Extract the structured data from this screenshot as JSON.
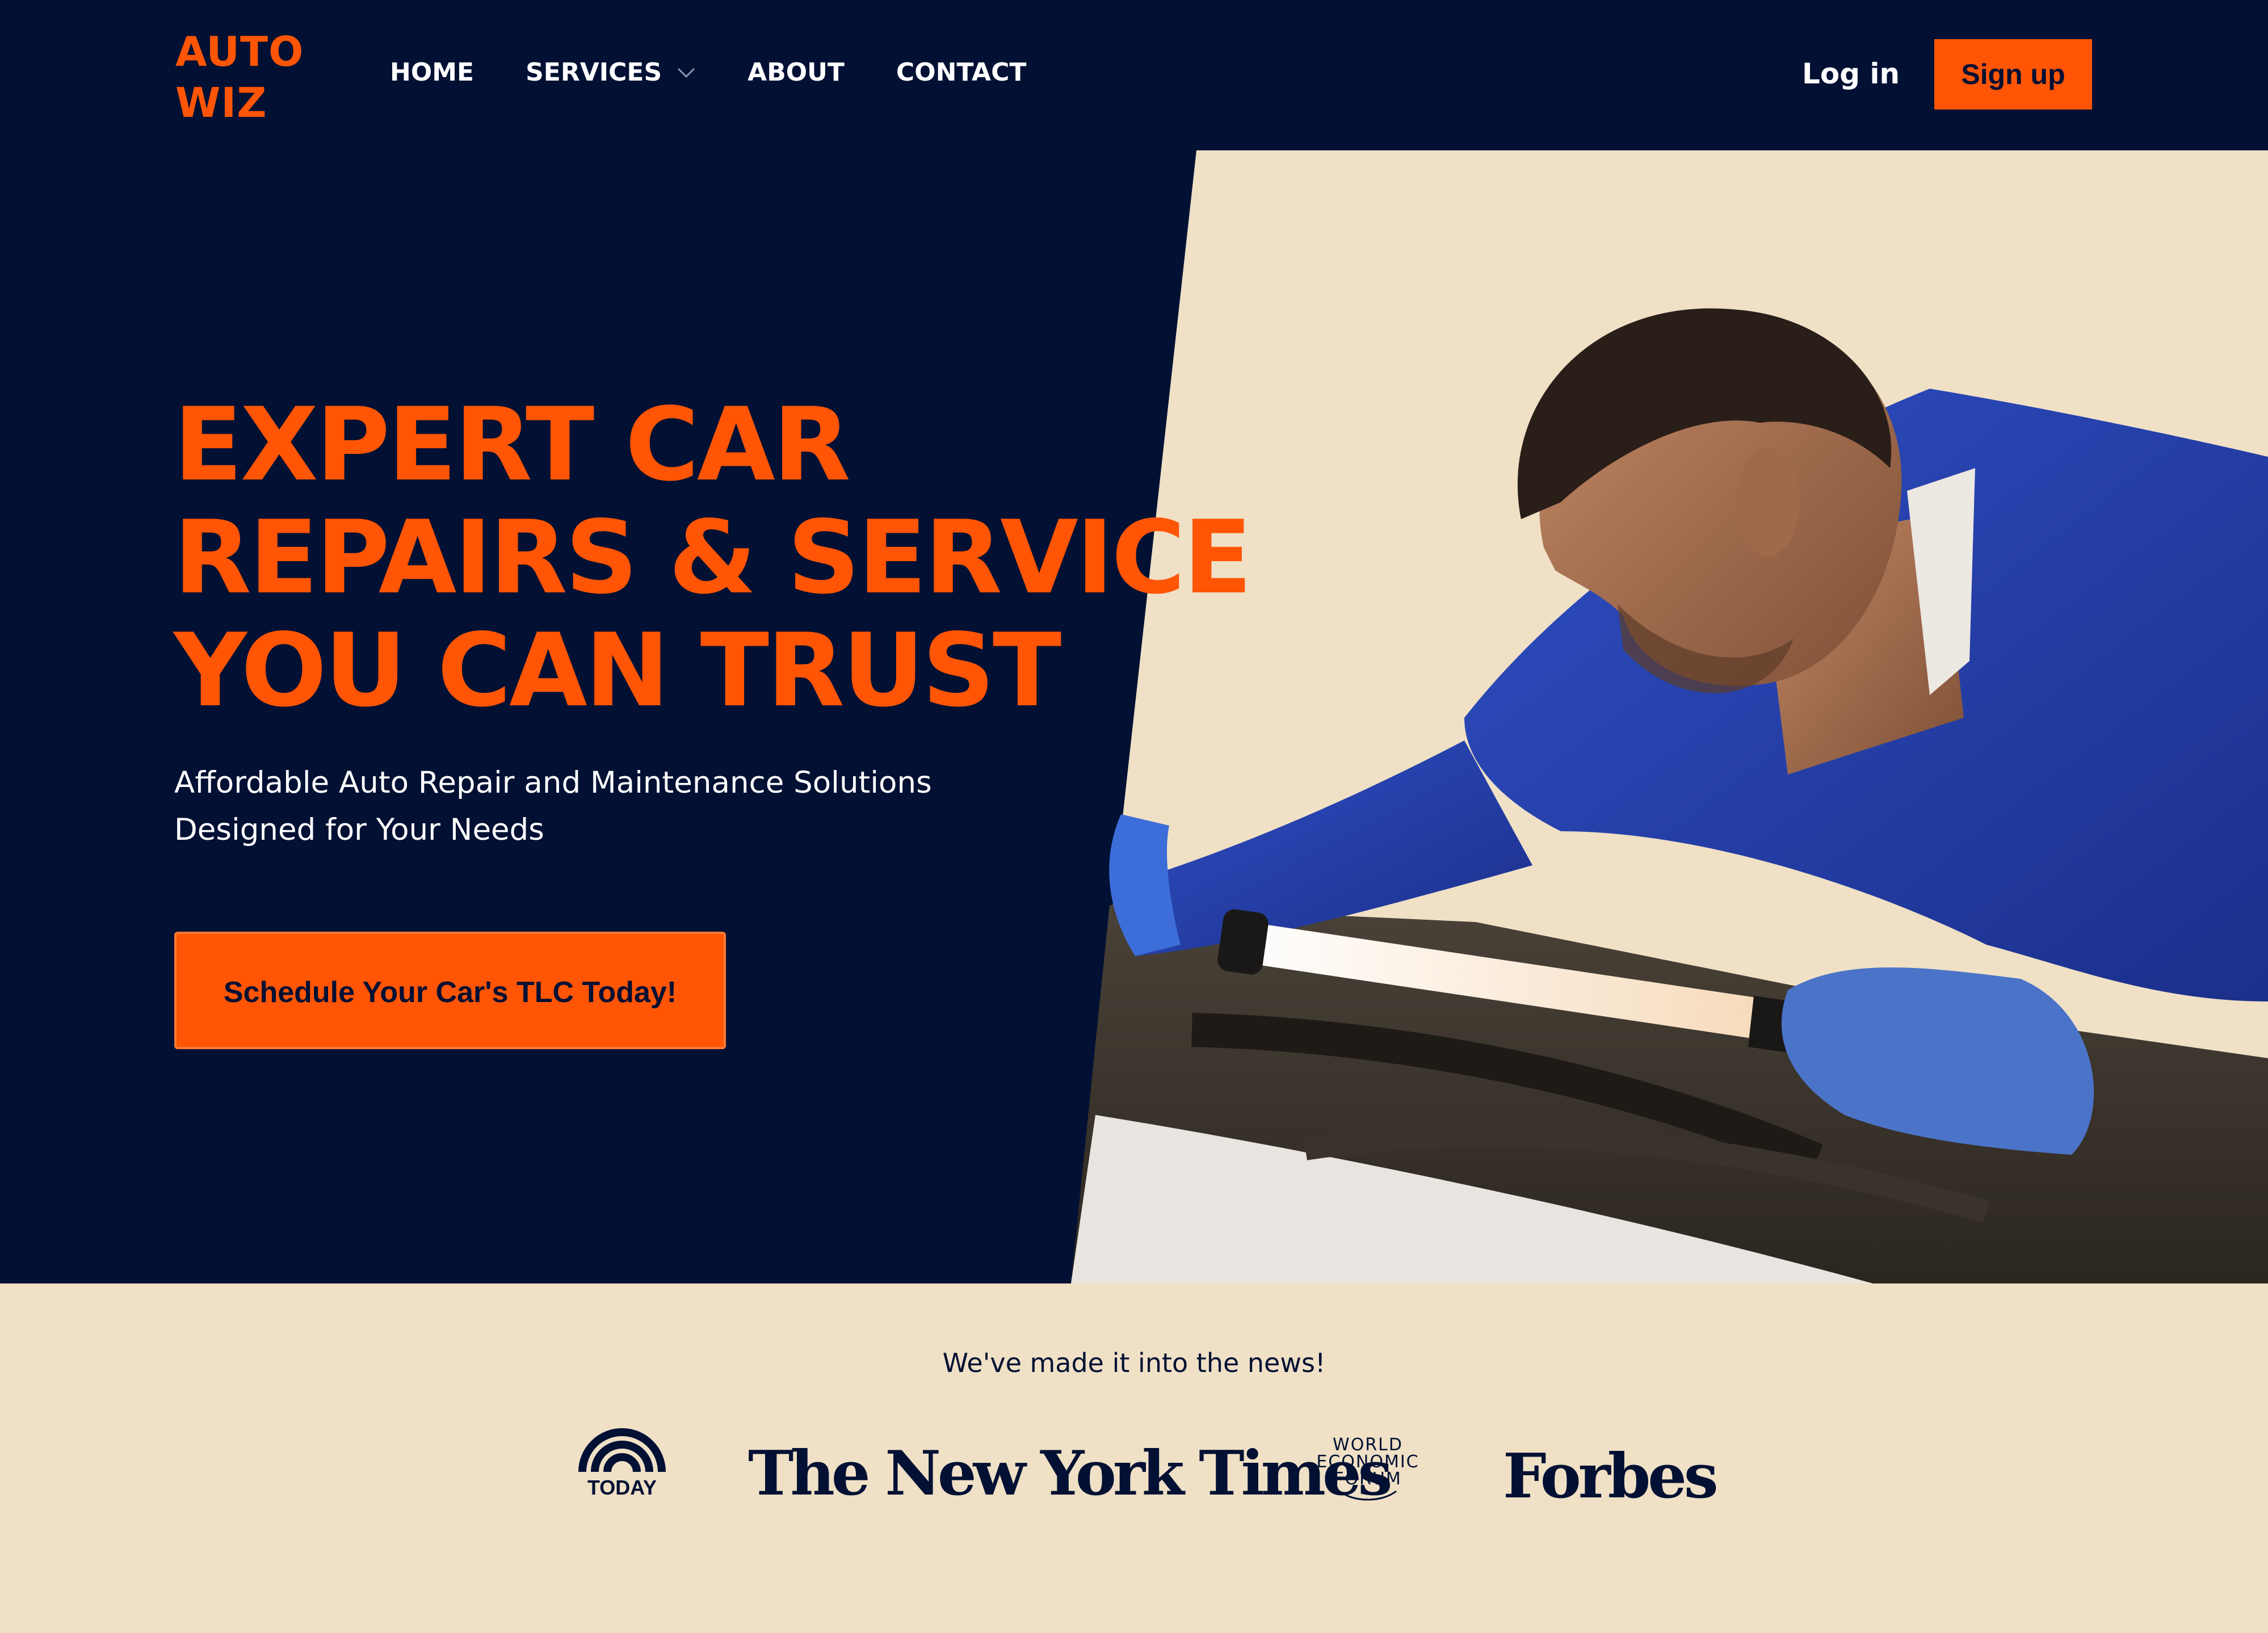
{
  "brand": {
    "name_line1": "AUTO",
    "name_line2": "WIZ"
  },
  "nav": {
    "items": [
      {
        "label": "HOME"
      },
      {
        "label": "SERVICES",
        "has_dropdown": true
      },
      {
        "label": "ABOUT"
      },
      {
        "label": "CONTACT"
      }
    ],
    "login_label": "Log in",
    "signup_label": "Sign up"
  },
  "hero": {
    "headline_lines": [
      "EXPERT CAR",
      "REPAIRS & SERVICE",
      "YOU CAN TRUST"
    ],
    "subtitle_lines": [
      "Affordable Auto Repair and Maintenance Solutions",
      "Designed for Your Needs"
    ],
    "cta_label": "Schedule Your Car's TLC Today!"
  },
  "news": {
    "title": "We've made it into the news!",
    "logos": {
      "today": "TODAY",
      "nyt": "The New York Times",
      "wef_lines": [
        "WORLD",
        "ECONOMIC",
        "FORUM"
      ],
      "forbes": "Forbes"
    }
  },
  "colors": {
    "navy": "#011033",
    "orange": "#ff5505",
    "beige": "#efe0c6"
  },
  "icons": {
    "dropdown": "chevron-down-icon"
  }
}
